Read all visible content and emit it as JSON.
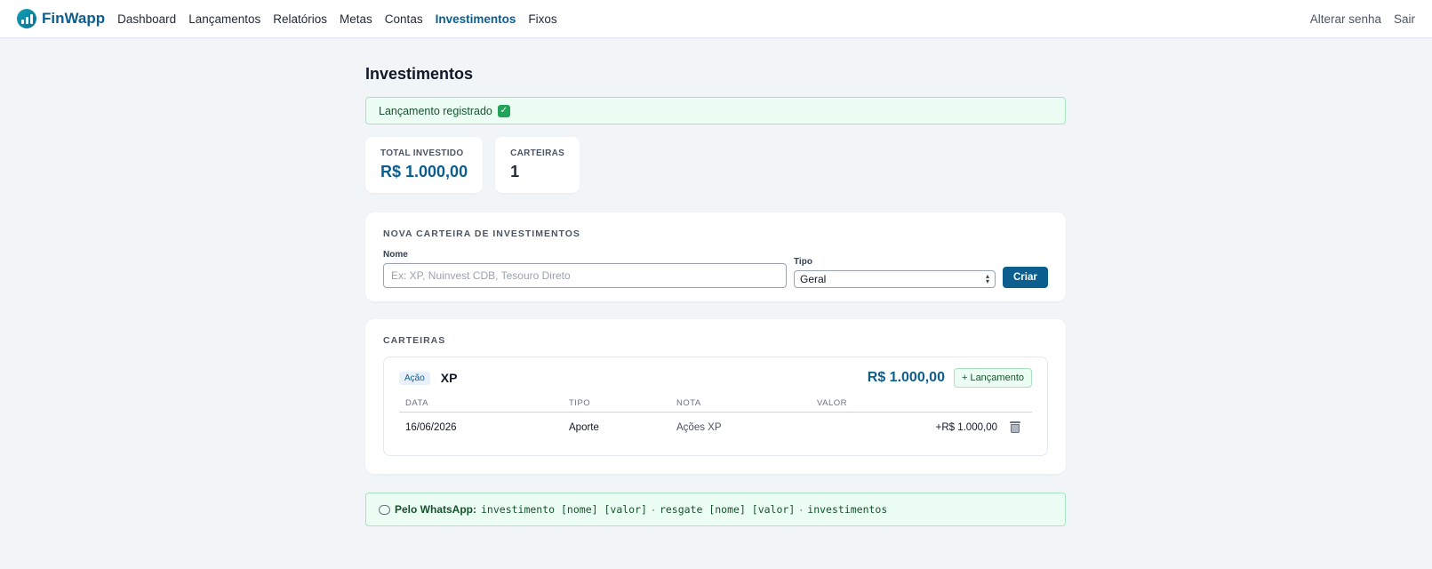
{
  "brand": {
    "name": "FinWapp"
  },
  "nav": {
    "items": [
      {
        "label": "Dashboard",
        "active": false
      },
      {
        "label": "Lançamentos",
        "active": false
      },
      {
        "label": "Relatórios",
        "active": false
      },
      {
        "label": "Metas",
        "active": false
      },
      {
        "label": "Contas",
        "active": false
      },
      {
        "label": "Investimentos",
        "active": true
      },
      {
        "label": "Fixos",
        "active": false
      }
    ],
    "change_password": "Alterar senha",
    "logout": "Sair"
  },
  "page": {
    "title": "Investimentos"
  },
  "flash": {
    "message": "Lançamento registrado",
    "icon": "check-icon"
  },
  "stats": {
    "total_label": "TOTAL INVESTIDO",
    "total_value": "R$ 1.000,00",
    "wallets_label": "CARTEIRAS",
    "wallets_value": "1"
  },
  "new_wallet": {
    "title": "NOVA CARTEIRA DE INVESTIMENTOS",
    "name_label": "Nome",
    "name_placeholder": "Ex: XP, Nuinvest CDB, Tesouro Direto",
    "name_value": "",
    "type_label": "Tipo",
    "type_value": "Geral",
    "submit_label": "Criar"
  },
  "wallets": {
    "title": "CARTEIRAS",
    "items": [
      {
        "badge": "Ação",
        "name": "XP",
        "total": "R$ 1.000,00",
        "add_label": "+ Lançamento",
        "columns": [
          "DATA",
          "TIPO",
          "NOTA",
          "VALOR"
        ],
        "rows": [
          {
            "date": "16/06/2026",
            "type": "Aporte",
            "note": "Ações XP",
            "value": "+R$ 1.000,00"
          }
        ]
      }
    ]
  },
  "tip": {
    "label": "Pelo WhatsApp:",
    "cmd1": "investimento [nome] [valor]",
    "sep1": "·",
    "cmd2": "resgate [nome] [valor]",
    "sep2": "·",
    "cmd3": "investimentos"
  },
  "colors": {
    "brand": "#0b5e8e",
    "success_bg": "#ecfdf3",
    "success_border": "#a7e3c0",
    "page_bg": "#f1f5f7"
  }
}
